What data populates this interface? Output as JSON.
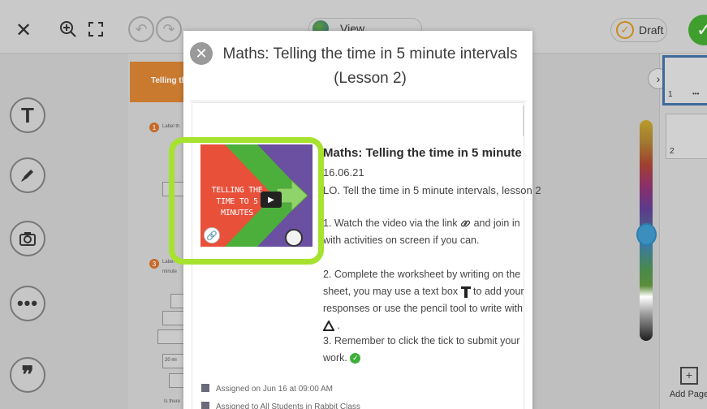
{
  "topbar": {
    "close_label": "✕",
    "view_instructions": "View Instructions",
    "draft_label": "Draft",
    "draft_badge": "✓",
    "submit_label": "✓"
  },
  "toolbar": {
    "text_tool": "T",
    "more_tool": "•••",
    "quote_tool": "❞"
  },
  "worksheet": {
    "header": "Telling the",
    "badge1": "1",
    "label1": "Label th",
    "badge2": "3",
    "label2": "Label",
    "label2b": "minute",
    "box_20": "20 mi",
    "footer_text": "Is there"
  },
  "pages": {
    "collapse": "›",
    "thumb1_num": "1",
    "thumb1_more": "•••",
    "thumb2_num": "2",
    "add_page_label": "Add Page"
  },
  "modal": {
    "close_label": "✕",
    "title": "Maths: Telling the time in 5 minute intervals (Lesson 2)",
    "video": {
      "thumbnail_text": "TELLING THE TIME TO 5 MINUTES"
    },
    "lesson_title": "Maths: Telling the time in 5 minute ...",
    "date": "16.06.21",
    "learning_objective": "LO. Tell the time in 5 minute intervals, lesson 2",
    "step1_a": "1. Watch the video via the link",
    "step1_b": "and join in with activities on screen if you can.",
    "step2_a": "2. Complete the worksheet by writing on the sheet, you may use a text box",
    "step2_b": "to add your responses or use the pencil tool to write with",
    "step2_c": ".",
    "step3_a": "3. Remember to click the tick to submit your work.",
    "assigned_date": "Assigned on Jun 16 at 09:00 AM",
    "assigned_to": "Assigned to All Students in Rabbit Class"
  },
  "colors": {
    "highlight": "#a6e22e",
    "video_red": "#e8503a",
    "video_green": "#4caf3c",
    "video_purple": "#6b4fa0",
    "tick_green": "#3fae3a"
  }
}
